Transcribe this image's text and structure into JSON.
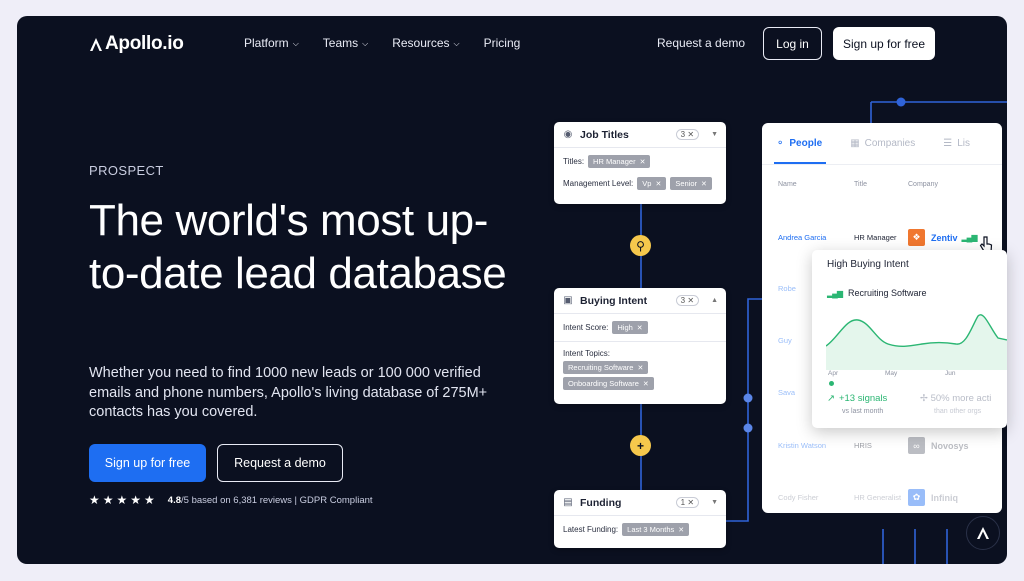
{
  "brand": {
    "name": "Apollo.io"
  },
  "nav": {
    "items": [
      {
        "label": "Platform",
        "has_dropdown": true
      },
      {
        "label": "Teams",
        "has_dropdown": true
      },
      {
        "label": "Resources",
        "has_dropdown": true
      },
      {
        "label": "Pricing",
        "has_dropdown": false
      }
    ],
    "request_demo": "Request a demo",
    "login": "Log in",
    "signup": "Sign up for free"
  },
  "hero": {
    "eyebrow": "PROSPECT",
    "headline": "The world's most up-to-date lead database",
    "subheadline": "Whether you need to find 1000 new leads or 100 000 verified emails and phone numbers, Apollo's living database of 275M+ contacts has you covered.",
    "cta_primary": "Sign up for free",
    "cta_secondary": "Request a demo",
    "rating_stars": 5,
    "rating_value": "4.8",
    "rating_text": "/5 based on 6,381 reviews | GDPR Compliant"
  },
  "filters": {
    "job_titles": {
      "title": "Job Titles",
      "count": "3",
      "titles_label": "Titles:",
      "titles_tag": "HR Manager",
      "mgmt_label": "Management Level:",
      "mgmt_tags": [
        "Vp",
        "Senior"
      ]
    },
    "buying_intent": {
      "title": "Buying Intent",
      "count": "3",
      "score_label": "Intent Score:",
      "score_tag": "High",
      "topics_label": "Intent Topics:",
      "topic_tags": [
        "Recruiting Software",
        "Onboarding Software"
      ]
    },
    "funding": {
      "title": "Funding",
      "count": "1",
      "latest_label": "Latest Funding:",
      "latest_tag": "Last 3 Months"
    }
  },
  "people_panel": {
    "tabs": [
      "People",
      "Companies",
      "Lis"
    ],
    "columns": [
      "Name",
      "Title",
      "Company"
    ],
    "rows": [
      {
        "name": "Andrea Garcia",
        "title": "HR Manager",
        "company": "Zentiv"
      },
      {
        "name": "Robe",
        "title": "",
        "company": ""
      },
      {
        "name": "Guy",
        "title": "",
        "company": ""
      },
      {
        "name": "Sava",
        "title": "",
        "company": ""
      },
      {
        "name": "Kristin Watson",
        "title": "HRIS",
        "company": "Novosys"
      },
      {
        "name": "Cody Fisher",
        "title": "HR Generalist",
        "company": "Infiniq"
      }
    ]
  },
  "intent_popup": {
    "title": "High Buying Intent",
    "topic": "Recruiting Software",
    "months": [
      "Apr",
      "May",
      "Jun"
    ],
    "signals": "+13 signals",
    "signals_sub": "vs last month",
    "more_activity": "50% more acti",
    "more_activity_sub": "than other orgs"
  },
  "colors": {
    "background": "#0b1020",
    "accent": "#1e6ef2",
    "highlight": "#f6c84c",
    "positive": "#2bb673"
  }
}
